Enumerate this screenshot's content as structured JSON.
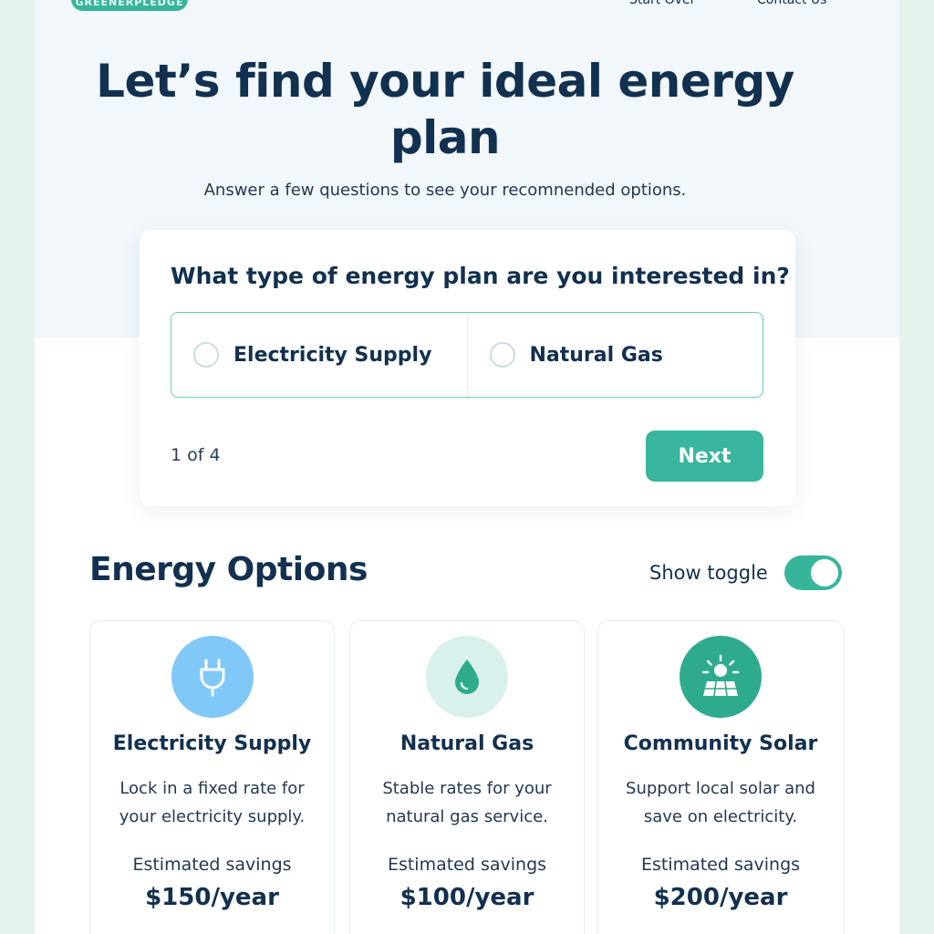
{
  "header": {
    "badge": "GREENERPLEDGE",
    "links": [
      "Start Over",
      "Contact Us"
    ]
  },
  "hero": {
    "title": "Let’s find your ideal energy plan",
    "subtitle": "Answer a few questions to see your recomnended options."
  },
  "quiz": {
    "question": "What type of energy plan are you interested in?",
    "options": [
      "Electricity Supply",
      "Natural Gas"
    ],
    "progress": "1 of 4",
    "next_label": "Next"
  },
  "section": {
    "title": "Energy Options",
    "toggle_label": "Show toggle",
    "toggle_on": true
  },
  "cards": [
    {
      "icon": "plug-icon",
      "title": "Electricity Supply",
      "description": "Lock in a fixed rate for your electricity supply.",
      "savings_label": "Estimated savings",
      "savings_value": "$150/year"
    },
    {
      "icon": "drop-icon",
      "title": "Natural Gas",
      "description": "Stable rates for your natural gas service.",
      "savings_label": "Estimated savings",
      "savings_value": "$100/year"
    },
    {
      "icon": "solar-panel-icon",
      "title": "Community Solar",
      "description": "Support local solar and save on electricity.",
      "savings_label": "Estimated savings",
      "savings_value": "$200/year"
    }
  ],
  "colors": {
    "accent": "#39b69d",
    "heading": "#12304f",
    "hero_bg": "#f1f7fb",
    "page_bg": "#e6f3ec"
  }
}
